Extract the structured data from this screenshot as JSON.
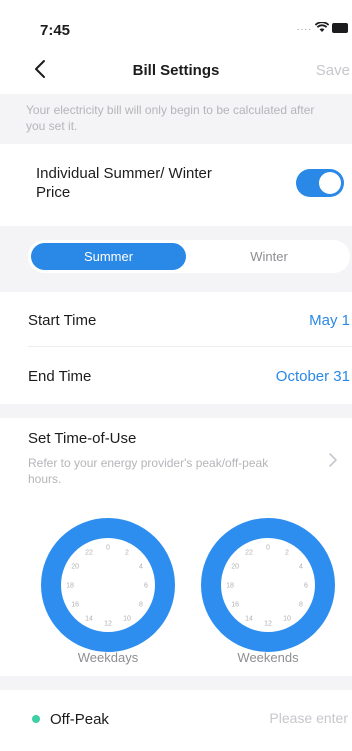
{
  "status_bar": {
    "time": "7:45",
    "signal": "....",
    "wifi_icon": "wifi-icon",
    "battery_icon": "battery-icon"
  },
  "nav": {
    "back_icon": "chevron-left-icon",
    "title": "Bill Settings",
    "save_label": "Save"
  },
  "notice": "Your electricity bill will only begin to be calculated after you set it.",
  "toggle": {
    "label": "Individual Summer/ Winter Price",
    "on": true,
    "accent": "#2a88e6"
  },
  "segments": {
    "options": [
      "Summer",
      "Winter"
    ],
    "selected": "Summer"
  },
  "season": {
    "start_label": "Start Time",
    "start_value": "May 1",
    "end_label": "End Time",
    "end_value": "October 31"
  },
  "time_of_use": {
    "title": "Set Time-of-Use",
    "description": "Refer to your energy provider's peak/off-peak hours.",
    "chevron_icon": "chevron-right-icon",
    "clock_hours": [
      "0",
      "2",
      "4",
      "6",
      "8",
      "10",
      "12",
      "14",
      "16",
      "18",
      "20",
      "22"
    ],
    "weekdays_label": "Weekdays",
    "weekends_label": "Weekends",
    "ring_color": "#2d8ef0"
  },
  "off_peak": {
    "label": "Off-Peak",
    "placeholder": "Please enter",
    "dot_color": "#3ecfa5"
  }
}
